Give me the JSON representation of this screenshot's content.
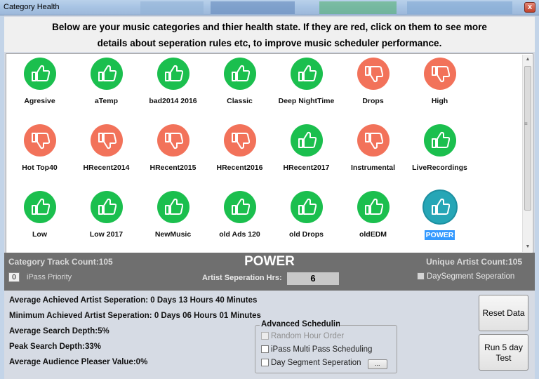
{
  "window": {
    "title": "Category Health",
    "close_glyph": "x"
  },
  "heading": {
    "line1": "Below are your music categories and thier health state. If they are red, click on them to see more",
    "line2": "details about seperation rules etc, to improve music scheduler performance."
  },
  "categories": [
    {
      "label": "Agresive",
      "status": "good"
    },
    {
      "label": "aTemp",
      "status": "good"
    },
    {
      "label": "bad2014 2016",
      "status": "good"
    },
    {
      "label": "Classic",
      "status": "good"
    },
    {
      "label": "Deep NightTime",
      "status": "good"
    },
    {
      "label": "Drops",
      "status": "bad"
    },
    {
      "label": "High",
      "status": "bad"
    },
    {
      "label": "Hot Top40",
      "status": "bad"
    },
    {
      "label": "HRecent2014",
      "status": "bad"
    },
    {
      "label": "HRecent2015",
      "status": "bad"
    },
    {
      "label": "HRecent2016",
      "status": "bad"
    },
    {
      "label": "HRecent2017",
      "status": "good"
    },
    {
      "label": "Instrumental",
      "status": "bad"
    },
    {
      "label": "LiveRecordings",
      "status": "good"
    },
    {
      "label": "Low",
      "status": "good"
    },
    {
      "label": "Low 2017",
      "status": "good"
    },
    {
      "label": "NewMusic",
      "status": "good"
    },
    {
      "label": "old Ads 120",
      "status": "good"
    },
    {
      "label": "old Drops",
      "status": "good"
    },
    {
      "label": "oldEDM",
      "status": "good"
    },
    {
      "label": "POWER",
      "status": "selected"
    }
  ],
  "icons": {
    "good": "thumbs-up-icon",
    "bad": "thumbs-down-icon",
    "selected": "thumbs-up-icon"
  },
  "colors": {
    "good": "#1bbf4e",
    "bad": "#f2725a",
    "selected": "#26a6b6"
  },
  "info": {
    "track_count": "Category Track Count:105",
    "selected_category": "POWER",
    "unique_artist_count": "Unique Artist Count:105",
    "ipass_value": "0",
    "ipass_label": "iPass Priority",
    "artist_sep_label": "Artist Seperation Hrs:",
    "artist_sep_value": "6",
    "dayseg_label": "DaySegment Seperation",
    "dayseg_checked": false
  },
  "stats": {
    "avg_artist_sep": "Average Achieved Artist Seperation: 0 Days 13 Hours 40 Minutes",
    "min_artist_sep": "Minimum Achieved Artist Seperation: 0 Days 06 Hours 01 Minutes",
    "avg_search_depth": "Average Search Depth:5%",
    "peak_search_depth": "Peak Search Depth:33%",
    "avg_audience": "Average Audience Pleaser Value:0%"
  },
  "advanced": {
    "legend": "Advanced Scheduling",
    "random_hour": "Random Hour Order",
    "ipass_multi": "iPass Multi Pass Scheduling",
    "day_segment": "Day Segment Seperation",
    "more_label": "..."
  },
  "buttons": {
    "reset": "Reset Data",
    "run_line1": "Run 5 day",
    "run_line2": "Test"
  }
}
